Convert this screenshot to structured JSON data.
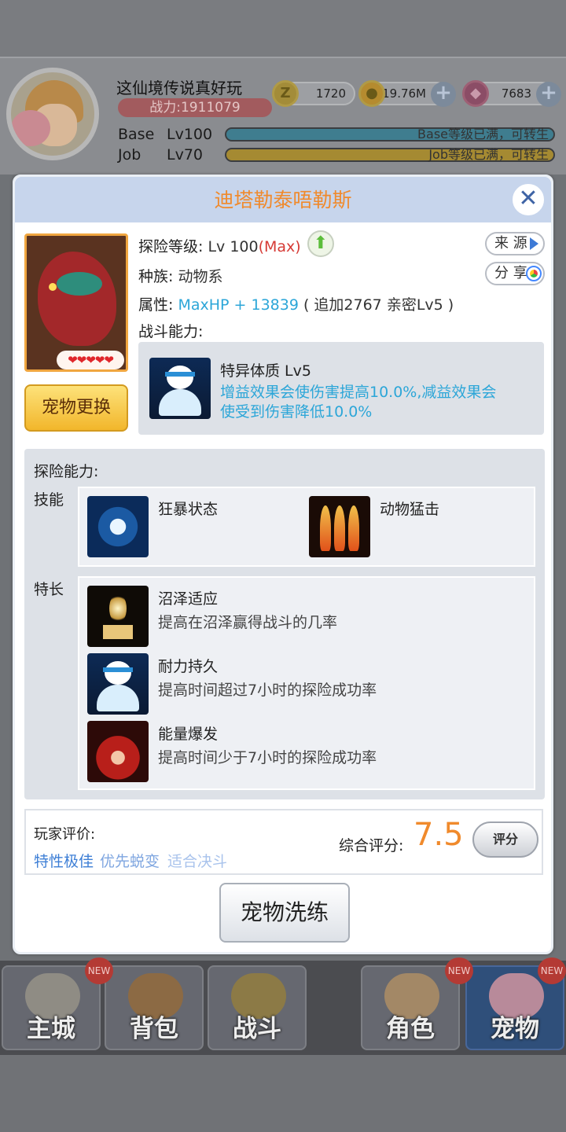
{
  "header": {
    "player_name": "这仙境传说真好玩",
    "power": "战力:1911079",
    "zeny": "1720",
    "gold": "19.76M",
    "gems": "7683",
    "base_label": "Base",
    "base_level": "Lv100",
    "base_status": "Base等级已满，可转生",
    "base_fill": 1.0,
    "job_label": "Job",
    "job_level": "Lv70",
    "job_status": "Job等级已满，可转生",
    "job_fill": 1.0
  },
  "dialog": {
    "title": "迪塔勒泰唔勒斯",
    "hearts": "❤❤❤❤❤",
    "change_pet_label": "宠物更换",
    "explore_level_label": "探险等级:",
    "explore_level_value": "Lv 100",
    "explore_level_max": "(Max)",
    "source_label": "来 源",
    "share_label": "分 享",
    "race_label": "种族:",
    "race_value": "动物系",
    "attr_label": "属性:",
    "attr_value": "MaxHP + 13839",
    "attr_bonus": "( 追加2767 亲密Lv5 )",
    "battle_label": "战斗能力:",
    "battle_ability": {
      "name": "特异体质 Lv5",
      "desc_line1": "增益效果会使伤害提高10.0%,减益效果会",
      "desc_line2": "使受到伤害降低10.0%"
    },
    "explore_label": "探险能力:",
    "skills_label": "技能",
    "skills": [
      "狂暴状态",
      "动物猛击"
    ],
    "specialty_label": "特长",
    "specialties": [
      {
        "name": "沼泽适应",
        "desc": "提高在沼泽赢得战斗的几率"
      },
      {
        "name": "耐力持久",
        "desc": "提高时间超过7小时的探险成功率"
      },
      {
        "name": "能量爆发",
        "desc": "提高时间少于7小时的探险成功率"
      }
    ],
    "review_label": "玩家评价:",
    "tags": [
      "特性极佳",
      "优先蜕变",
      "适合决斗"
    ],
    "score_label": "综合评分:",
    "score": "7.5",
    "rate_label": "评分",
    "wash_label": "宠物洗练"
  },
  "nav": {
    "items": [
      "主城",
      "背包",
      "战斗",
      "角色",
      "宠物"
    ],
    "new_badge": "NEW"
  },
  "colors": {
    "accent_orange": "#f08a2c",
    "highlight_blue": "#2ca6d8",
    "max_red": "#d63a35",
    "tag1": "#3e7fd6",
    "tag2": "#7fa6e0",
    "tag3": "#a9c3ec"
  }
}
